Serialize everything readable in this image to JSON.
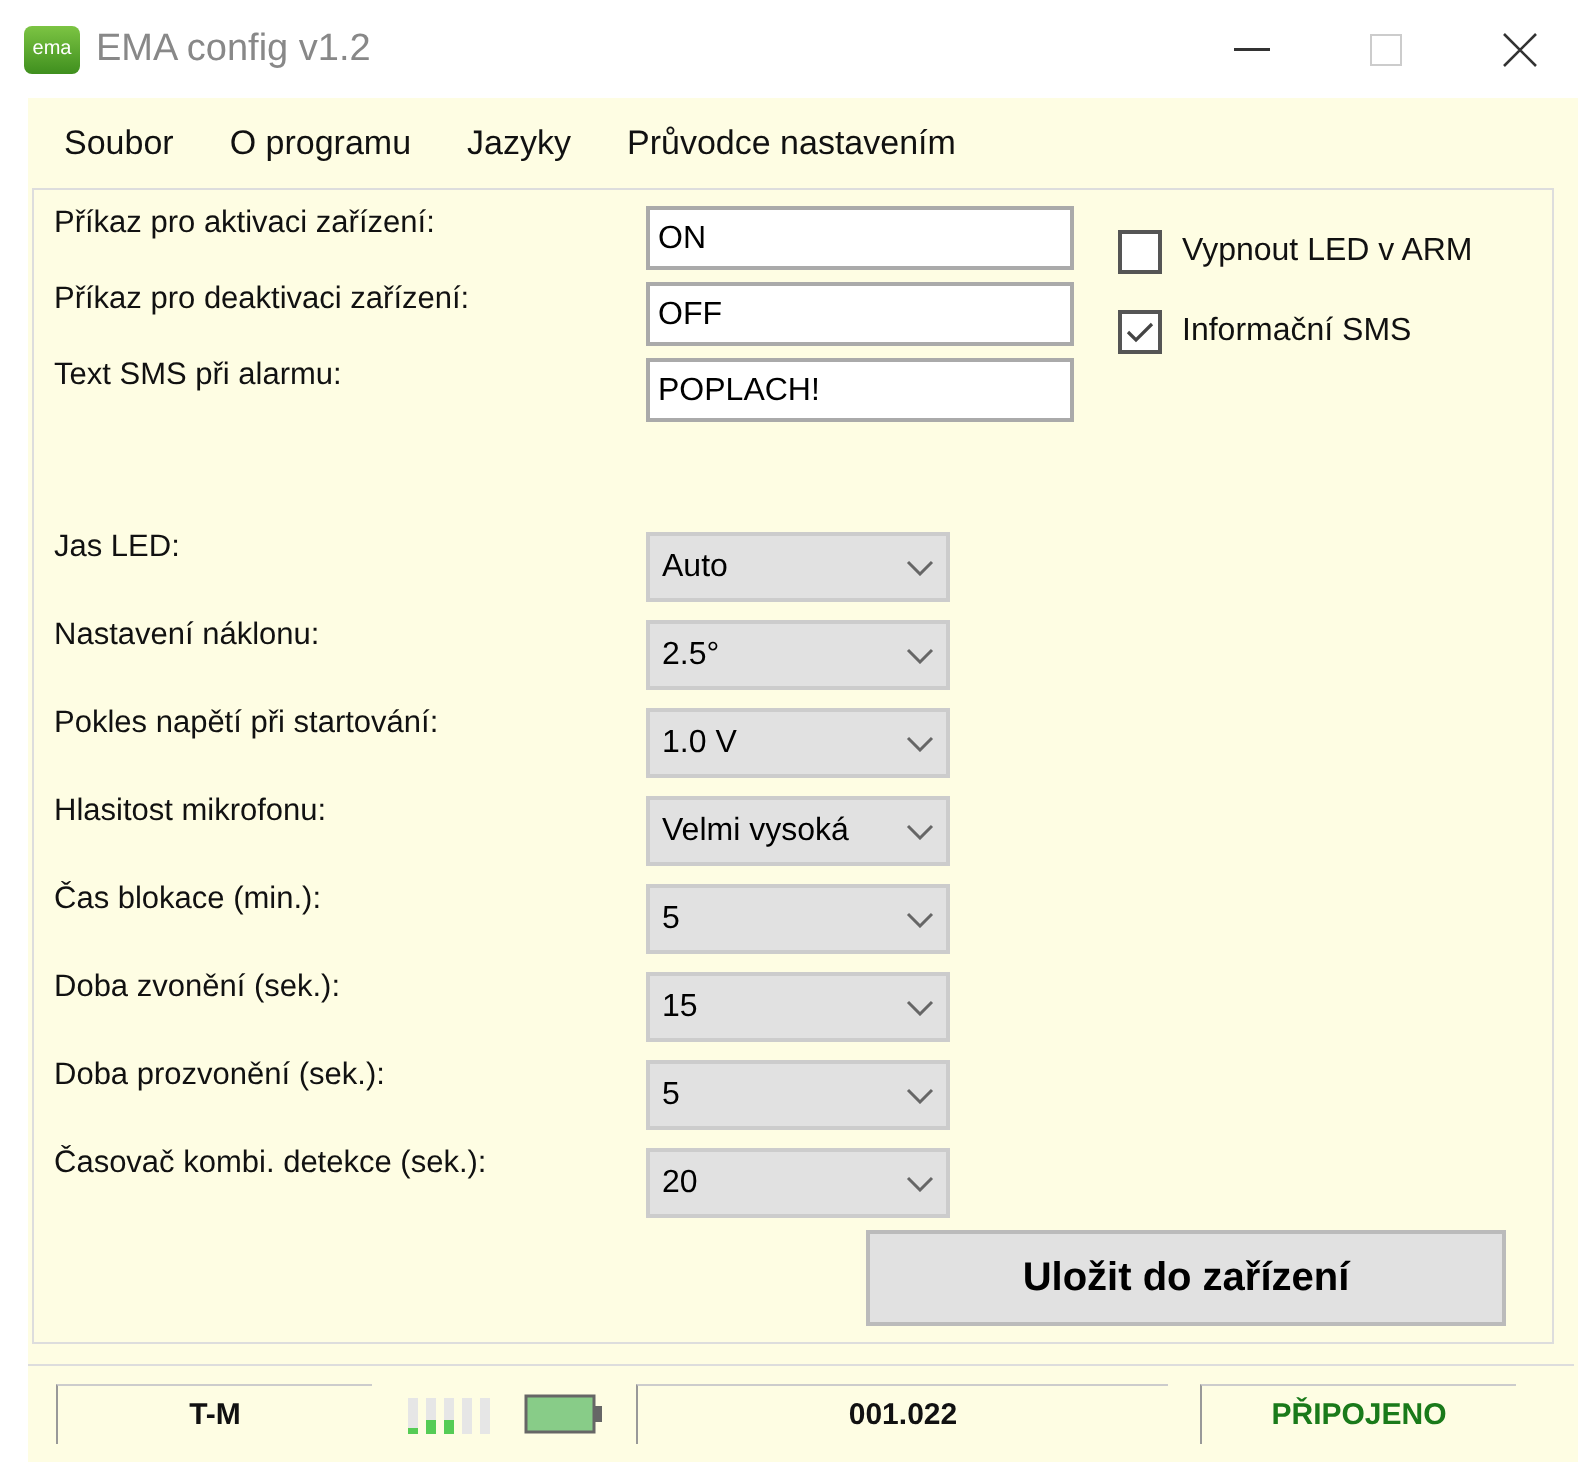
{
  "window": {
    "title": "EMA config v1.2",
    "logo": "ema"
  },
  "menu": [
    "Soubor",
    "O programu",
    "Jazyky",
    "Průvodce nastavením"
  ],
  "text_fields": [
    {
      "label": "Příkaz pro aktivaci zařízení:",
      "value": "ON"
    },
    {
      "label": "Příkaz pro deaktivaci zařízení:",
      "value": "OFF"
    },
    {
      "label": "Text SMS při alarmu:",
      "value": "POPLACH!"
    }
  ],
  "checkboxes": [
    {
      "label": "Vypnout LED v ARM",
      "checked": false
    },
    {
      "label": "Informační SMS",
      "checked": true
    }
  ],
  "dropdowns": [
    {
      "label": "Jas LED:",
      "value": "Auto"
    },
    {
      "label": "Nastavení náklonu:",
      "value": "2.5°"
    },
    {
      "label": "Pokles napětí při startování:",
      "value": "1.0 V"
    },
    {
      "label": "Hlasitost mikrofonu:",
      "value": "Velmi vysoká"
    },
    {
      "label": "Čas blokace (min.):",
      "value": "5"
    },
    {
      "label": "Doba zvonění (sek.):",
      "value": "15"
    },
    {
      "label": "Doba prozvonění (sek.):",
      "value": "5"
    },
    {
      "label": "Časovač kombi. detekce (sek.):",
      "value": "20"
    }
  ],
  "save_button": "Uložit do zařízení",
  "status_bar": {
    "operator": "T-M",
    "version": "001.022",
    "status": "PŘIPOJENO"
  }
}
